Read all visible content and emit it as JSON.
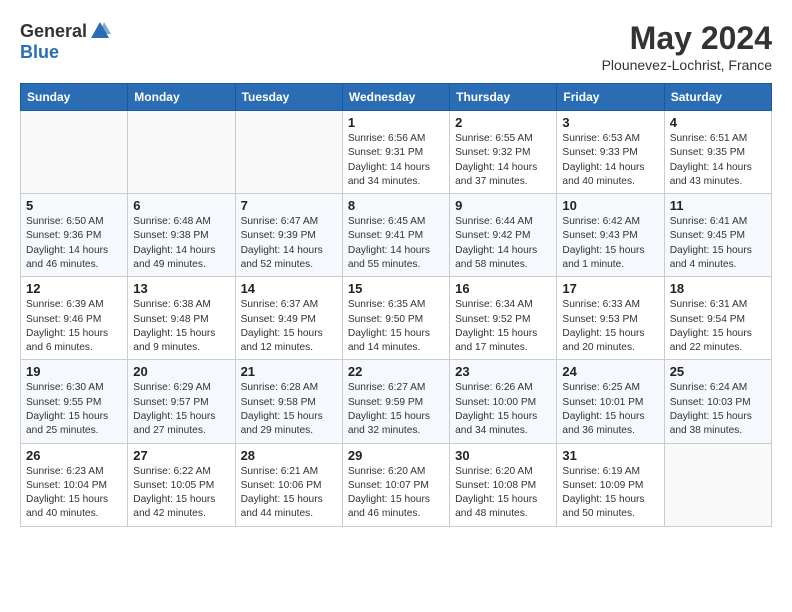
{
  "header": {
    "logo_general": "General",
    "logo_blue": "Blue",
    "month_title": "May 2024",
    "location": "Plounevez-Lochrist, France"
  },
  "weekdays": [
    "Sunday",
    "Monday",
    "Tuesday",
    "Wednesday",
    "Thursday",
    "Friday",
    "Saturday"
  ],
  "weeks": [
    [
      {
        "day": "",
        "info": ""
      },
      {
        "day": "",
        "info": ""
      },
      {
        "day": "",
        "info": ""
      },
      {
        "day": "1",
        "info": "Sunrise: 6:56 AM\nSunset: 9:31 PM\nDaylight: 14 hours and 34 minutes."
      },
      {
        "day": "2",
        "info": "Sunrise: 6:55 AM\nSunset: 9:32 PM\nDaylight: 14 hours and 37 minutes."
      },
      {
        "day": "3",
        "info": "Sunrise: 6:53 AM\nSunset: 9:33 PM\nDaylight: 14 hours and 40 minutes."
      },
      {
        "day": "4",
        "info": "Sunrise: 6:51 AM\nSunset: 9:35 PM\nDaylight: 14 hours and 43 minutes."
      }
    ],
    [
      {
        "day": "5",
        "info": "Sunrise: 6:50 AM\nSunset: 9:36 PM\nDaylight: 14 hours and 46 minutes."
      },
      {
        "day": "6",
        "info": "Sunrise: 6:48 AM\nSunset: 9:38 PM\nDaylight: 14 hours and 49 minutes."
      },
      {
        "day": "7",
        "info": "Sunrise: 6:47 AM\nSunset: 9:39 PM\nDaylight: 14 hours and 52 minutes."
      },
      {
        "day": "8",
        "info": "Sunrise: 6:45 AM\nSunset: 9:41 PM\nDaylight: 14 hours and 55 minutes."
      },
      {
        "day": "9",
        "info": "Sunrise: 6:44 AM\nSunset: 9:42 PM\nDaylight: 14 hours and 58 minutes."
      },
      {
        "day": "10",
        "info": "Sunrise: 6:42 AM\nSunset: 9:43 PM\nDaylight: 15 hours and 1 minute."
      },
      {
        "day": "11",
        "info": "Sunrise: 6:41 AM\nSunset: 9:45 PM\nDaylight: 15 hours and 4 minutes."
      }
    ],
    [
      {
        "day": "12",
        "info": "Sunrise: 6:39 AM\nSunset: 9:46 PM\nDaylight: 15 hours and 6 minutes."
      },
      {
        "day": "13",
        "info": "Sunrise: 6:38 AM\nSunset: 9:48 PM\nDaylight: 15 hours and 9 minutes."
      },
      {
        "day": "14",
        "info": "Sunrise: 6:37 AM\nSunset: 9:49 PM\nDaylight: 15 hours and 12 minutes."
      },
      {
        "day": "15",
        "info": "Sunrise: 6:35 AM\nSunset: 9:50 PM\nDaylight: 15 hours and 14 minutes."
      },
      {
        "day": "16",
        "info": "Sunrise: 6:34 AM\nSunset: 9:52 PM\nDaylight: 15 hours and 17 minutes."
      },
      {
        "day": "17",
        "info": "Sunrise: 6:33 AM\nSunset: 9:53 PM\nDaylight: 15 hours and 20 minutes."
      },
      {
        "day": "18",
        "info": "Sunrise: 6:31 AM\nSunset: 9:54 PM\nDaylight: 15 hours and 22 minutes."
      }
    ],
    [
      {
        "day": "19",
        "info": "Sunrise: 6:30 AM\nSunset: 9:55 PM\nDaylight: 15 hours and 25 minutes."
      },
      {
        "day": "20",
        "info": "Sunrise: 6:29 AM\nSunset: 9:57 PM\nDaylight: 15 hours and 27 minutes."
      },
      {
        "day": "21",
        "info": "Sunrise: 6:28 AM\nSunset: 9:58 PM\nDaylight: 15 hours and 29 minutes."
      },
      {
        "day": "22",
        "info": "Sunrise: 6:27 AM\nSunset: 9:59 PM\nDaylight: 15 hours and 32 minutes."
      },
      {
        "day": "23",
        "info": "Sunrise: 6:26 AM\nSunset: 10:00 PM\nDaylight: 15 hours and 34 minutes."
      },
      {
        "day": "24",
        "info": "Sunrise: 6:25 AM\nSunset: 10:01 PM\nDaylight: 15 hours and 36 minutes."
      },
      {
        "day": "25",
        "info": "Sunrise: 6:24 AM\nSunset: 10:03 PM\nDaylight: 15 hours and 38 minutes."
      }
    ],
    [
      {
        "day": "26",
        "info": "Sunrise: 6:23 AM\nSunset: 10:04 PM\nDaylight: 15 hours and 40 minutes."
      },
      {
        "day": "27",
        "info": "Sunrise: 6:22 AM\nSunset: 10:05 PM\nDaylight: 15 hours and 42 minutes."
      },
      {
        "day": "28",
        "info": "Sunrise: 6:21 AM\nSunset: 10:06 PM\nDaylight: 15 hours and 44 minutes."
      },
      {
        "day": "29",
        "info": "Sunrise: 6:20 AM\nSunset: 10:07 PM\nDaylight: 15 hours and 46 minutes."
      },
      {
        "day": "30",
        "info": "Sunrise: 6:20 AM\nSunset: 10:08 PM\nDaylight: 15 hours and 48 minutes."
      },
      {
        "day": "31",
        "info": "Sunrise: 6:19 AM\nSunset: 10:09 PM\nDaylight: 15 hours and 50 minutes."
      },
      {
        "day": "",
        "info": ""
      }
    ]
  ]
}
